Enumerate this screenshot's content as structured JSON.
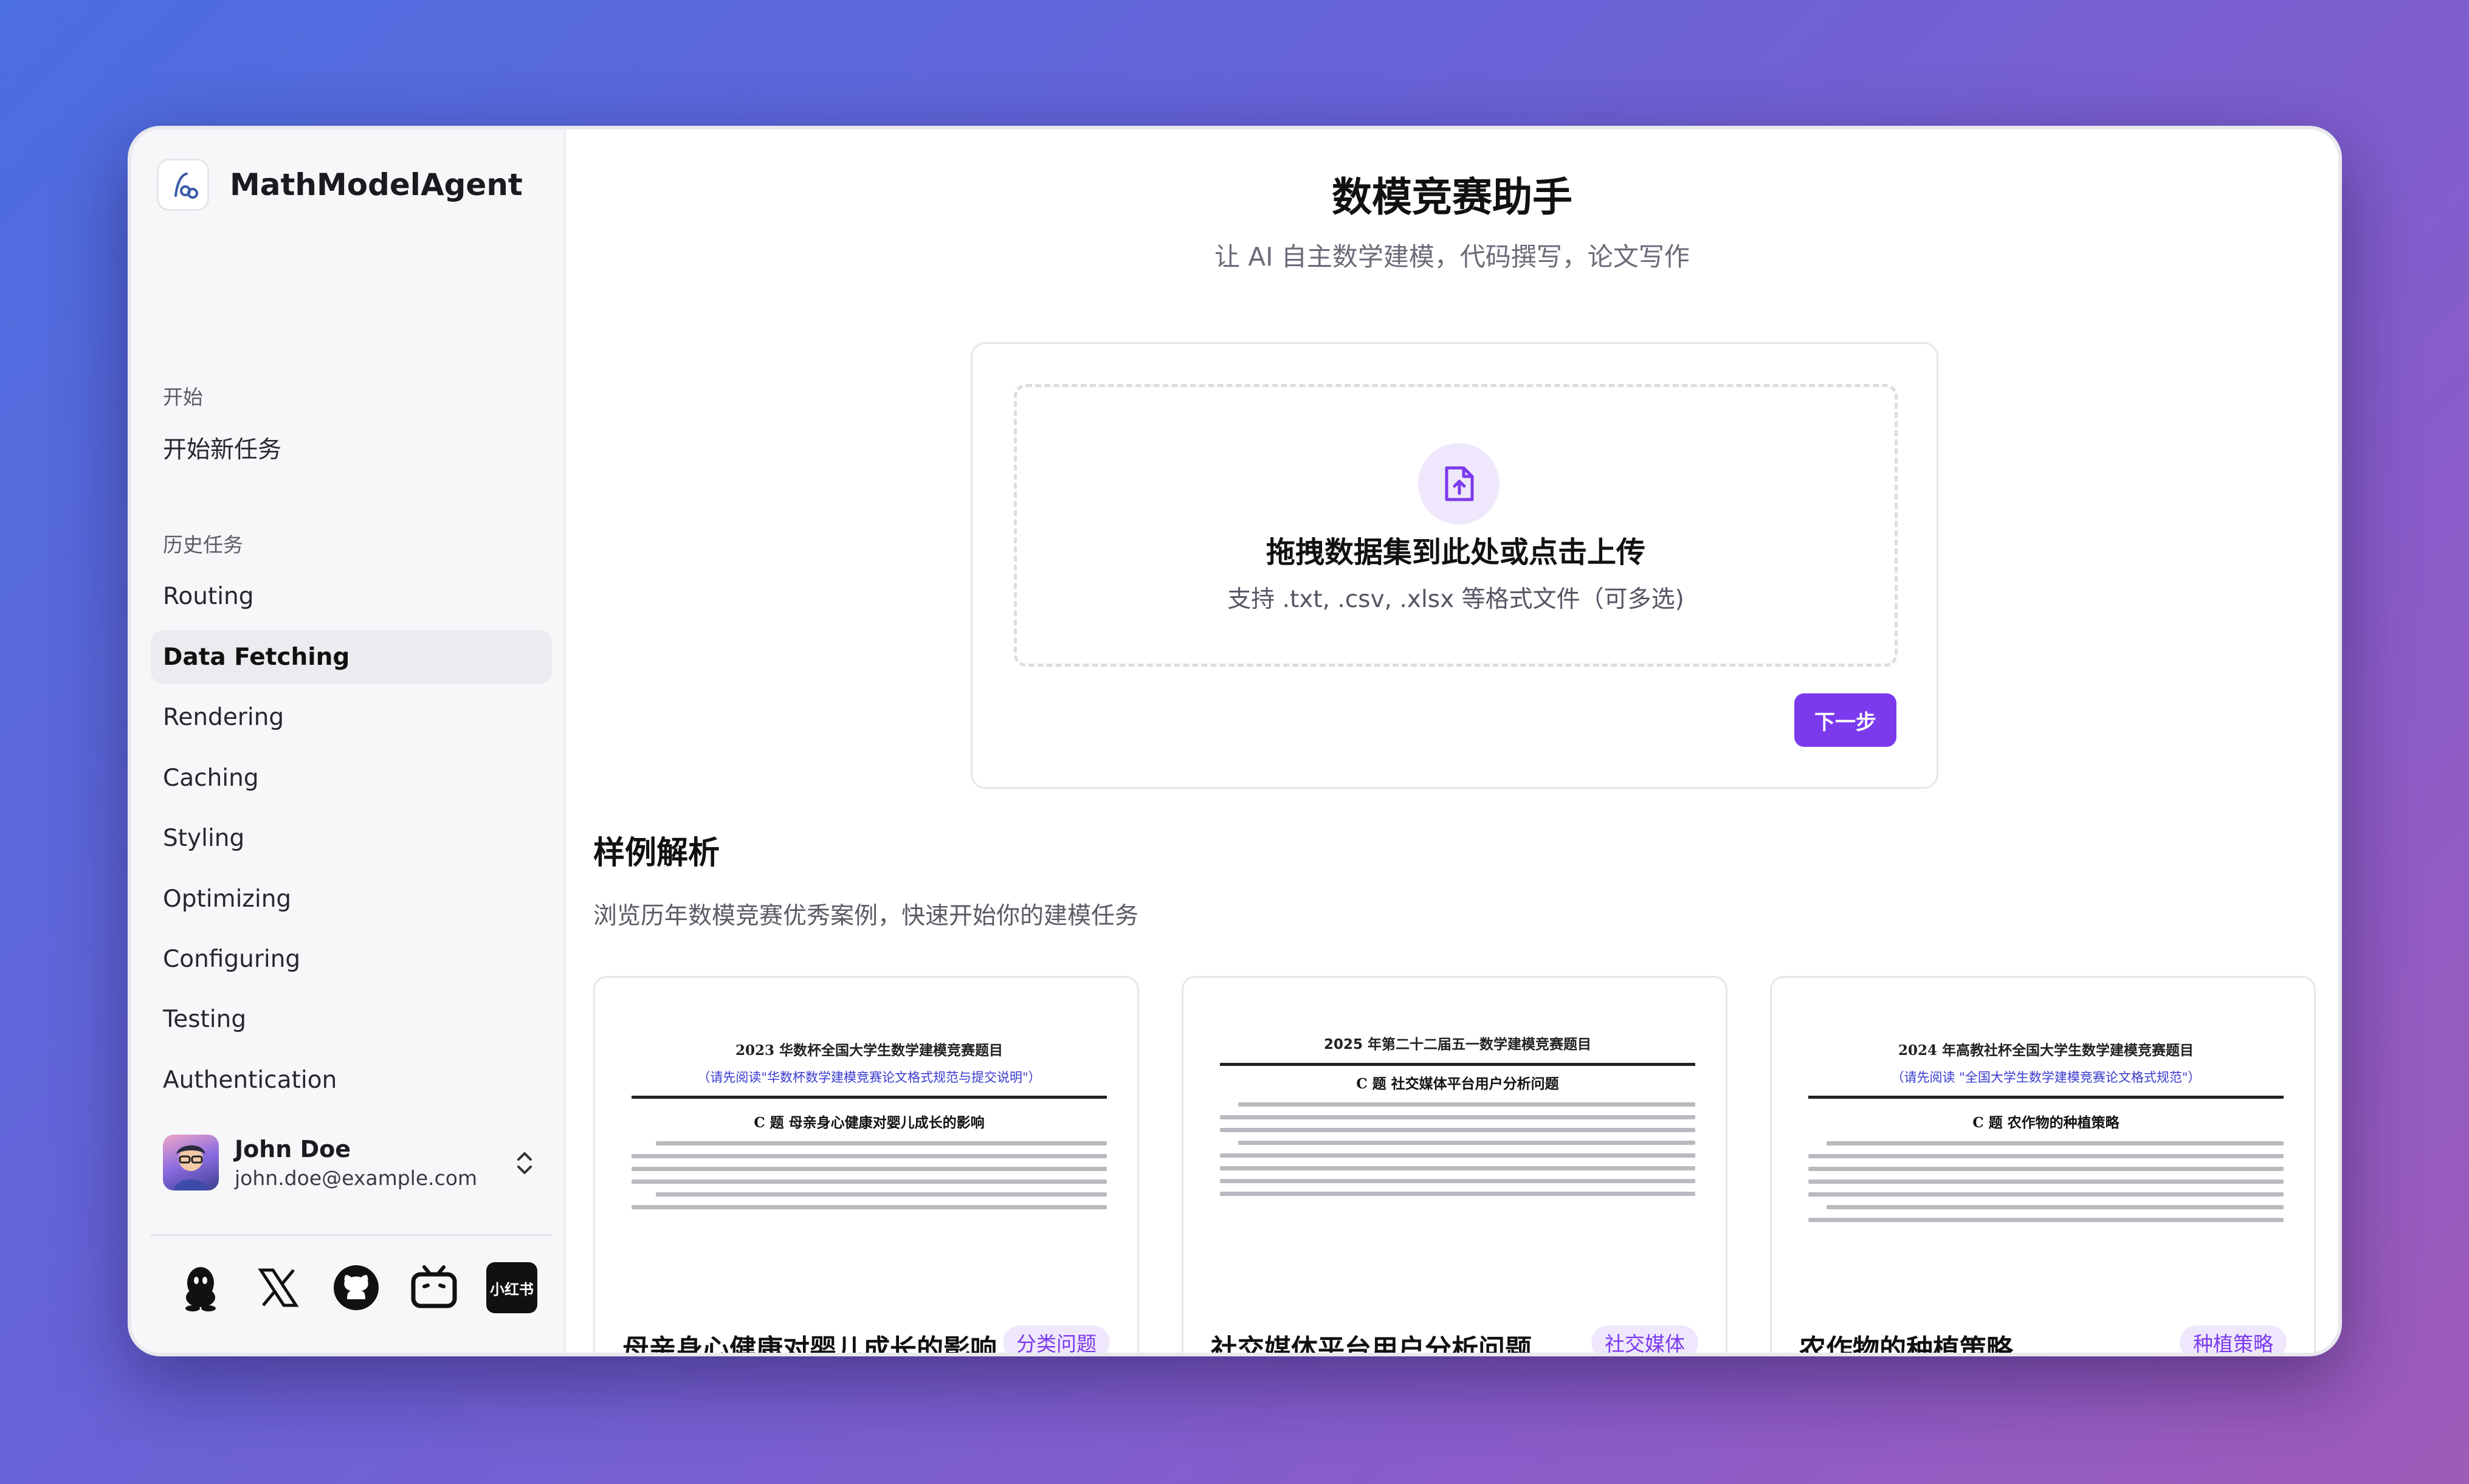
{
  "app": {
    "name": "MathModelAgent",
    "accent_color": "#7c3aed"
  },
  "sidebar": {
    "sections": [
      {
        "label": "开始",
        "items": [
          {
            "label": "开始新任务"
          }
        ]
      },
      {
        "label": "历史任务",
        "items": [
          {
            "label": "Routing"
          },
          {
            "label": "Data Fetching",
            "active": true
          },
          {
            "label": "Rendering"
          },
          {
            "label": "Caching"
          },
          {
            "label": "Styling"
          },
          {
            "label": "Optimizing"
          },
          {
            "label": "Configuring"
          },
          {
            "label": "Testing"
          },
          {
            "label": "Authentication"
          }
        ]
      }
    ],
    "user": {
      "name": "John Doe",
      "email": "john.doe@example.com"
    },
    "social_icons": [
      "qq-icon",
      "x-icon",
      "github-icon",
      "bilibili-icon",
      "xiaohongshu-icon"
    ],
    "xiaohongshu_label": "小红书"
  },
  "main": {
    "title": "数模竞赛助手",
    "subtitle": "让 AI 自主数学建模，代码撰写，论文写作",
    "upload": {
      "title": "拖拽数据集到此处或点击上传",
      "hint": "支持 .txt, .csv, .xlsx 等格式文件（可多选)",
      "next_label": "下一步"
    },
    "examples": {
      "title": "样例解析",
      "description": "浏览历年数模竞赛优秀案例，快速开始你的建模任务",
      "cards": [
        {
          "doc_header": "2023 华数杯全国大学生数学建模竞赛题目",
          "doc_sub": "（请先阅读\"华数杯数学建模竞赛论文格式规范与提交说明\"）",
          "doc_question": "C 题  母亲身心健康对婴儿成长的影响",
          "title": "母亲身心健康对婴儿成长的影响",
          "tag": "分类问题"
        },
        {
          "doc_header": "2025 年第二十二届五一数学建模竞赛题目",
          "doc_sub": "",
          "doc_question": "C 题  社交媒体平台用户分析问题",
          "title": "社交媒体平台用户分析问题",
          "tag": "社交媒体"
        },
        {
          "doc_header": "2024 年高教社杯全国大学生数学建模竞赛题目",
          "doc_sub": "（请先阅读 \"全国大学生数学建模竞赛论文格式规范\"）",
          "doc_question": "C 题    农作物的种植策略",
          "title": "农作物的种植策略",
          "tag": "种植策略"
        }
      ]
    }
  }
}
